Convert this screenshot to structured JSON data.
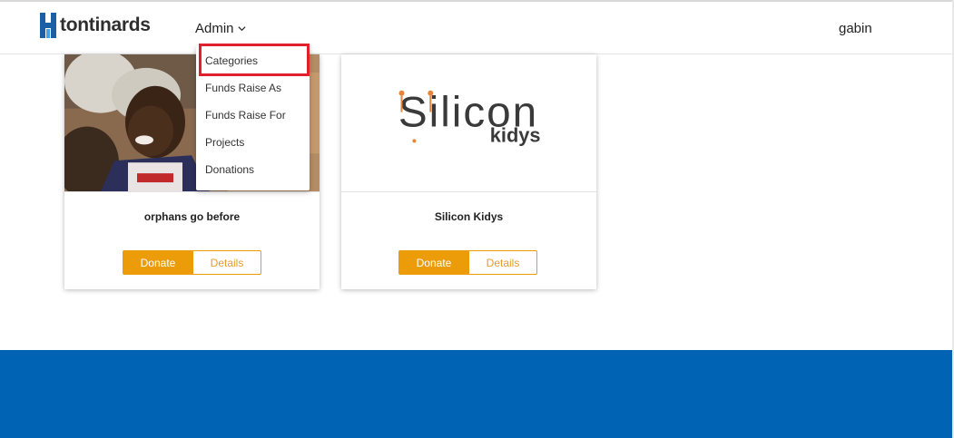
{
  "brand": {
    "name": "tontinards",
    "mark_color": "#1b5fa6"
  },
  "nav": {
    "admin_label": "Admin",
    "user_label": "gabin"
  },
  "admin_dropdown": {
    "items": [
      {
        "label": "Categories",
        "highlighted": true
      },
      {
        "label": "Funds Raise As"
      },
      {
        "label": "Funds Raise For"
      },
      {
        "label": "Projects"
      },
      {
        "label": "Donations"
      }
    ]
  },
  "projects": [
    {
      "title": "orphans go before",
      "image": "photo-child-smiling",
      "donate_label": "Donate",
      "details_label": "Details"
    },
    {
      "title": "Silicon Kidys",
      "image": "silicon-kidys-logo",
      "logo_text_top": "Silicon",
      "logo_text_bottom": "kidys",
      "donate_label": "Donate",
      "details_label": "Details"
    }
  ],
  "colors": {
    "accent": "#ed9c09",
    "footer": "#0063b4",
    "highlight_border": "#e0202a"
  }
}
